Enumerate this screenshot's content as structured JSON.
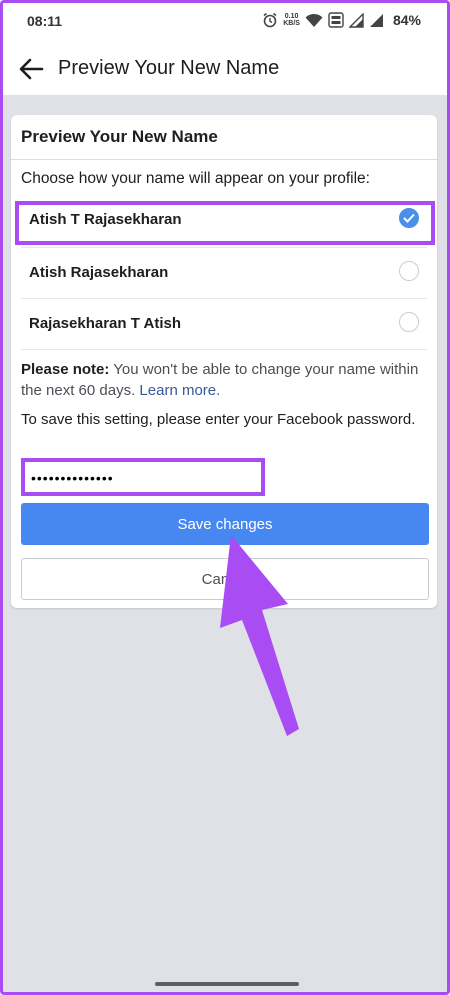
{
  "status_bar": {
    "time": "08:11",
    "speed_value": "0.10",
    "speed_unit": "KB/S",
    "battery": "84%"
  },
  "header": {
    "title": "Preview Your New Name"
  },
  "card": {
    "title": "Preview Your New Name",
    "instruction": "Choose how your name will appear on your profile:",
    "options": [
      {
        "label": "Atish T Rajasekharan",
        "selected": true
      },
      {
        "label": "Atish Rajasekharan",
        "selected": false
      },
      {
        "label": "Rajasekharan T Atish",
        "selected": false
      }
    ],
    "note_bold": "Please note:",
    "note_text": " You won't be able to change your name within the next 60 days. ",
    "learn_more": "Learn more.",
    "save_prompt": "To save this setting, please enter your Facebook password.",
    "password_value": "••••••••••••••",
    "save_label": "Save changes",
    "cancel_label": "Cancel"
  },
  "colors": {
    "accent_highlight": "#a94cf3",
    "primary_button": "#4687f2",
    "radio_checked": "#4a90e8"
  }
}
